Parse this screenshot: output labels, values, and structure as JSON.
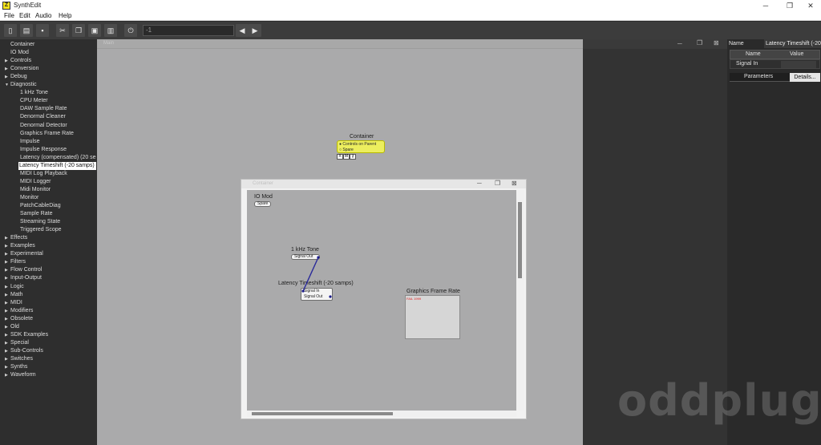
{
  "window": {
    "title": "SynthEdit",
    "app_icon": "Z"
  },
  "menu": [
    "File",
    "Edit",
    "Audio",
    "Help"
  ],
  "toolbar": {
    "zoom_value": "-1"
  },
  "sidebar": {
    "items": [
      {
        "label": "Container",
        "arrow": ""
      },
      {
        "label": "IO Mod",
        "arrow": ""
      },
      {
        "label": "Controls",
        "arrow": "▶"
      },
      {
        "label": "Conversion",
        "arrow": "▶"
      },
      {
        "label": "Debug",
        "arrow": "▶"
      },
      {
        "label": "Diagnostic",
        "arrow": "▼"
      },
      {
        "label": "1 kHz Tone",
        "arrow": "",
        "child": true
      },
      {
        "label": "CPU Meter",
        "arrow": "",
        "child": true
      },
      {
        "label": "DAW Sample Rate",
        "arrow": "",
        "child": true
      },
      {
        "label": "Denormal Cleaner",
        "arrow": "",
        "child": true
      },
      {
        "label": "Denormal Detector",
        "arrow": "",
        "child": true
      },
      {
        "label": "Graphics Frame Rate",
        "arrow": "",
        "child": true
      },
      {
        "label": "Impulse",
        "arrow": "",
        "child": true
      },
      {
        "label": "Impulse Response",
        "arrow": "",
        "child": true
      },
      {
        "label": "Latency (compensated) (20 se",
        "arrow": "",
        "child": true
      },
      {
        "label": "Latency Timeshift (-20 samps)",
        "arrow": "",
        "child": true,
        "selected": true
      },
      {
        "label": "MIDI Log Playback",
        "arrow": "",
        "child": true
      },
      {
        "label": "MIDI Logger",
        "arrow": "",
        "child": true
      },
      {
        "label": "Midi Monitor",
        "arrow": "",
        "child": true
      },
      {
        "label": "Monitor",
        "arrow": "",
        "child": true
      },
      {
        "label": "PatchCableDiag",
        "arrow": "",
        "child": true
      },
      {
        "label": "Sample Rate",
        "arrow": "",
        "child": true
      },
      {
        "label": "Streaming State",
        "arrow": "",
        "child": true
      },
      {
        "label": "Triggered Scope",
        "arrow": "",
        "child": true
      },
      {
        "label": "Effects",
        "arrow": "▶"
      },
      {
        "label": "Examples",
        "arrow": "▶"
      },
      {
        "label": "Experimental",
        "arrow": "▶"
      },
      {
        "label": "Filters",
        "arrow": "▶"
      },
      {
        "label": "Flow Control",
        "arrow": "▶"
      },
      {
        "label": "Input-Output",
        "arrow": "▶"
      },
      {
        "label": "Logic",
        "arrow": "▶"
      },
      {
        "label": "Math",
        "arrow": "▶"
      },
      {
        "label": "MIDI",
        "arrow": "▶"
      },
      {
        "label": "Modifiers",
        "arrow": "▶"
      },
      {
        "label": "Obsolete",
        "arrow": "▶"
      },
      {
        "label": "Old",
        "arrow": "▶"
      },
      {
        "label": "SDK Examples",
        "arrow": "▶"
      },
      {
        "label": "Special",
        "arrow": "▶"
      },
      {
        "label": "Sub-Controls",
        "arrow": "▶"
      },
      {
        "label": "Switches",
        "arrow": "▶"
      },
      {
        "label": "Synths",
        "arrow": "▶"
      },
      {
        "label": "Waveform",
        "arrow": "▶"
      }
    ]
  },
  "main": {
    "tab_label": "Main",
    "container_module": {
      "title": "Container",
      "pin1": "Controls on Parent",
      "pin2": "Spare",
      "btns": [
        "X",
        "M",
        "🔒"
      ]
    }
  },
  "subwindow": {
    "title": "Container",
    "io_mod": {
      "title": "IO Mod",
      "pin": "Spare"
    },
    "tone": {
      "title": "1 kHz Tone",
      "pin": "Signal Out"
    },
    "latency": {
      "title": "Latency Timeshift (-20 samps)",
      "pin_in": "Signal In",
      "pin_out": "Signal Out"
    },
    "frame_rate": {
      "title": "Graphics Frame Rate",
      "readout": "FAIL 1999"
    }
  },
  "properties": {
    "name_label": "Name",
    "name_value": "Latency Timeshift (-20",
    "col_name": "Name",
    "col_value": "Value",
    "row1_name": "Signal In",
    "row1_value": "",
    "tab_parameters": "Parameters",
    "tab_details": "Details..."
  },
  "watermark": "oddplug",
  "colors": {
    "container_fill": "#ecee5e",
    "wire": "#2a2a9a",
    "sel_bg": "#ffffff",
    "canvas": "#aaaaab"
  }
}
